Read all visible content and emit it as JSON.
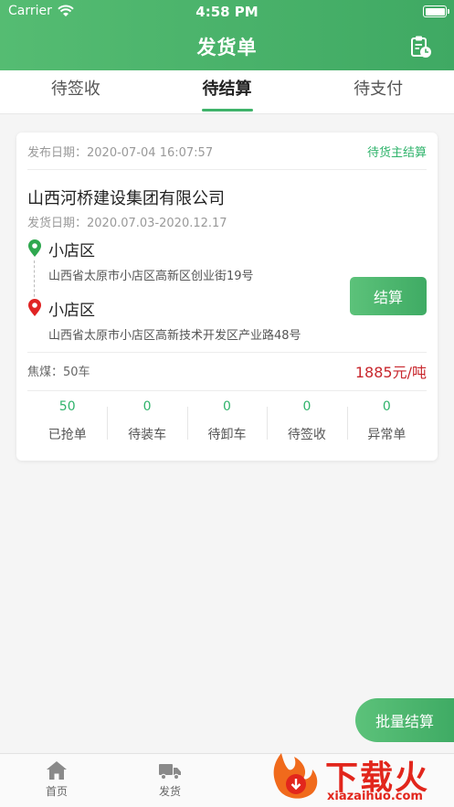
{
  "status_bar": {
    "carrier": "Carrier",
    "time": "4:58 PM"
  },
  "nav": {
    "title": "发货单",
    "icon": "clipboard-clock-icon"
  },
  "tabs": [
    {
      "label": "待签收",
      "active": false
    },
    {
      "label": "待结算",
      "active": true
    },
    {
      "label": "待支付",
      "active": false
    }
  ],
  "order": {
    "publish_label": "发布日期：",
    "publish_date": "2020-07-04 16:07:57",
    "status": "待货主结算",
    "company": "山西河桥建设集团有限公司",
    "ship_label": "发货日期：",
    "ship_range": "2020.07.03-2020.12.17",
    "origin": {
      "name": "小店区",
      "address": "山西省太原市小店区高新区创业街19号"
    },
    "destination": {
      "name": "小店区",
      "address": "山西省太原市小店区高新技术开发区产业路48号"
    },
    "settle_label": "结算",
    "cargo": "焦煤：",
    "trucks": "50车",
    "price": "1885元/吨",
    "stats": [
      {
        "value": "50",
        "label": "已抢单"
      },
      {
        "value": "0",
        "label": "待装车"
      },
      {
        "value": "0",
        "label": "待卸车"
      },
      {
        "value": "0",
        "label": "待签收"
      },
      {
        "value": "0",
        "label": "异常单"
      }
    ]
  },
  "batch_settle_label": "批量结算",
  "bottom_nav": [
    {
      "label": "首页",
      "icon": "home-icon"
    },
    {
      "label": "发货",
      "icon": "truck-icon"
    }
  ],
  "watermark": {
    "text": "下载火",
    "url": "xiazaihuo.com"
  },
  "colors": {
    "brand": "#3fab64",
    "accent_text": "#2fb36b",
    "price": "#c8272d",
    "origin_pin": "#2fa84f",
    "destination_pin": "#e02424"
  }
}
